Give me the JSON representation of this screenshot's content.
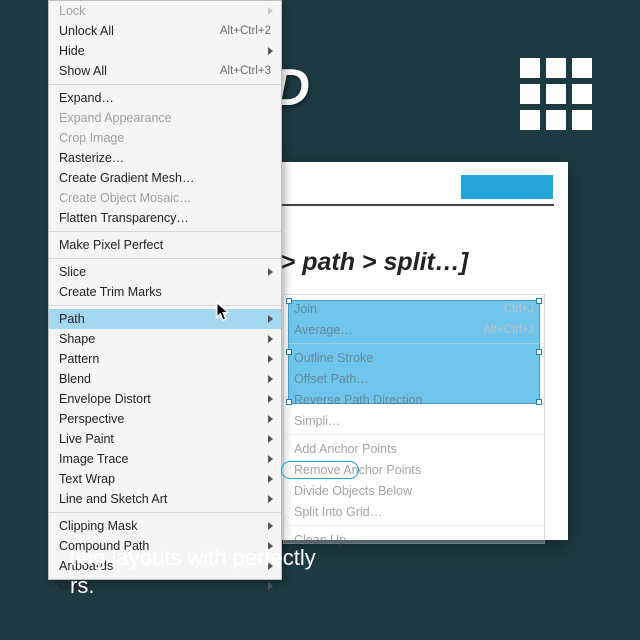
{
  "title_fragment": "O GRID",
  "breadcrumb": "[object > path > split…]",
  "caption_line1": "ting layouts with perfectly",
  "caption_line2": "rs.",
  "menu": {
    "items": [
      {
        "label": "Lock",
        "shortcut": "",
        "submenu": true,
        "disabled": true,
        "sepAfter": false
      },
      {
        "label": "Unlock All",
        "shortcut": "Alt+Ctrl+2",
        "submenu": false,
        "disabled": false,
        "sepAfter": false
      },
      {
        "label": "Hide",
        "shortcut": "",
        "submenu": true,
        "disabled": false,
        "sepAfter": false
      },
      {
        "label": "Show All",
        "shortcut": "Alt+Ctrl+3",
        "submenu": false,
        "disabled": false,
        "sepAfter": true
      },
      {
        "label": "Expand…",
        "shortcut": "",
        "submenu": false,
        "disabled": false,
        "sepAfter": false
      },
      {
        "label": "Expand Appearance",
        "shortcut": "",
        "submenu": false,
        "disabled": true,
        "sepAfter": false
      },
      {
        "label": "Crop Image",
        "shortcut": "",
        "submenu": false,
        "disabled": true,
        "sepAfter": false
      },
      {
        "label": "Rasterize…",
        "shortcut": "",
        "submenu": false,
        "disabled": false,
        "sepAfter": false
      },
      {
        "label": "Create Gradient Mesh…",
        "shortcut": "",
        "submenu": false,
        "disabled": false,
        "sepAfter": false
      },
      {
        "label": "Create Object Mosaic…",
        "shortcut": "",
        "submenu": false,
        "disabled": true,
        "sepAfter": false
      },
      {
        "label": "Flatten Transparency…",
        "shortcut": "",
        "submenu": false,
        "disabled": false,
        "sepAfter": true
      },
      {
        "label": "Make Pixel Perfect",
        "shortcut": "",
        "submenu": false,
        "disabled": false,
        "sepAfter": true
      },
      {
        "label": "Slice",
        "shortcut": "",
        "submenu": true,
        "disabled": false,
        "sepAfter": false
      },
      {
        "label": "Create Trim Marks",
        "shortcut": "",
        "submenu": false,
        "disabled": false,
        "sepAfter": true
      },
      {
        "label": "Path",
        "shortcut": "",
        "submenu": true,
        "disabled": false,
        "sepAfter": false,
        "hover": true
      },
      {
        "label": "Shape",
        "shortcut": "",
        "submenu": true,
        "disabled": false,
        "sepAfter": false
      },
      {
        "label": "Pattern",
        "shortcut": "",
        "submenu": true,
        "disabled": false,
        "sepAfter": false
      },
      {
        "label": "Blend",
        "shortcut": "",
        "submenu": true,
        "disabled": false,
        "sepAfter": false
      },
      {
        "label": "Envelope Distort",
        "shortcut": "",
        "submenu": true,
        "disabled": false,
        "sepAfter": false
      },
      {
        "label": "Perspective",
        "shortcut": "",
        "submenu": true,
        "disabled": false,
        "sepAfter": false
      },
      {
        "label": "Live Paint",
        "shortcut": "",
        "submenu": true,
        "disabled": false,
        "sepAfter": false
      },
      {
        "label": "Image Trace",
        "shortcut": "",
        "submenu": true,
        "disabled": false,
        "sepAfter": false
      },
      {
        "label": "Text Wrap",
        "shortcut": "",
        "submenu": true,
        "disabled": false,
        "sepAfter": false
      },
      {
        "label": "Line and Sketch Art",
        "shortcut": "",
        "submenu": true,
        "disabled": false,
        "sepAfter": true
      },
      {
        "label": "Clipping Mask",
        "shortcut": "",
        "submenu": true,
        "disabled": false,
        "sepAfter": false
      },
      {
        "label": "Compound Path",
        "shortcut": "",
        "submenu": true,
        "disabled": false,
        "sepAfter": false
      },
      {
        "label": "Artboards",
        "shortcut": "",
        "submenu": true,
        "disabled": false,
        "sepAfter": false
      },
      {
        "label": "Graph",
        "shortcut": "",
        "submenu": true,
        "disabled": false,
        "sepAfter": false
      }
    ]
  },
  "submenu": {
    "items": [
      {
        "label": "Join",
        "shortcut": "Ctrl+J",
        "disabled": true,
        "sepAfter": false
      },
      {
        "label": "Average…",
        "shortcut": "Alt+Ctrl+J",
        "disabled": true,
        "sepAfter": true
      },
      {
        "label": "Outline Stroke",
        "shortcut": "",
        "disabled": true,
        "sepAfter": false
      },
      {
        "label": "Offset Path…",
        "shortcut": "",
        "disabled": true,
        "sepAfter": false
      },
      {
        "label": "Reverse Path Direction",
        "shortcut": "",
        "disabled": true,
        "sepAfter": false
      },
      {
        "label": "Simpli…",
        "shortcut": "",
        "disabled": true,
        "sepAfter": true
      },
      {
        "label": "Add Anchor Points",
        "shortcut": "",
        "disabled": true,
        "sepAfter": false
      },
      {
        "label": "Remove Anchor Points",
        "shortcut": "",
        "disabled": true,
        "sepAfter": false
      },
      {
        "label": "Divide Objects Below",
        "shortcut": "",
        "disabled": true,
        "sepAfter": false
      },
      {
        "label": "Split Into Grid…",
        "shortcut": "",
        "disabled": true,
        "sepAfter": true
      },
      {
        "label": "Clean Up…",
        "shortcut": "",
        "disabled": true,
        "sepAfter": false
      }
    ]
  }
}
